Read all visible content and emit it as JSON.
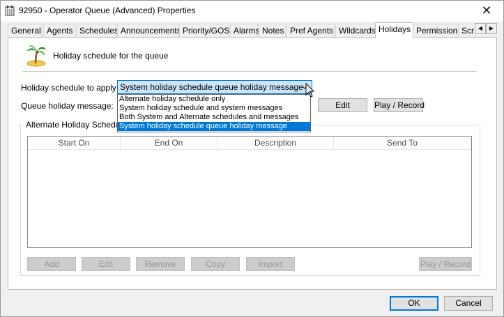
{
  "window": {
    "title": "92950 - Operator Queue (Advanced) Properties",
    "close_label": "✕"
  },
  "tabs": [
    {
      "label": "General"
    },
    {
      "label": "Agents"
    },
    {
      "label": "Schedules"
    },
    {
      "label": "Announcements"
    },
    {
      "label": "Priority/GOS"
    },
    {
      "label": "Alarms"
    },
    {
      "label": "Notes"
    },
    {
      "label": "Pref Agents"
    },
    {
      "label": "Wildcards"
    },
    {
      "label": "Holidays",
      "active": true
    },
    {
      "label": "Permissions"
    },
    {
      "label": "Scr"
    }
  ],
  "tab_scroll": {
    "left": "◀",
    "right": "▶"
  },
  "holidays": {
    "header": "Holiday schedule for the queue",
    "schedule_label": "Holiday schedule to apply:",
    "schedule_value": "System holiday schedule queue holiday message",
    "schedule_options": [
      "Alternate holiday schedule only",
      "System holiday schedule and system messages",
      "Both System and Alternate schedules and messages",
      "System holiday schedule queue holiday message"
    ],
    "selected_option_index": 3,
    "message_label": "Queue holiday message:",
    "edit_button": "Edit",
    "play_record_button": "Play / Record",
    "alternate_group_label": "Alternate Holiday Schedule",
    "columns": [
      "Start On",
      "End On",
      "Description",
      "Send To"
    ],
    "rows": [],
    "actions": {
      "add": "Add",
      "edit": "Edit",
      "remove": "Remove",
      "copy": "Copy",
      "import": "Import",
      "play_record": "Play / Record"
    }
  },
  "footer": {
    "ok": "OK",
    "cancel": "Cancel"
  },
  "icons": [
    "queue-app-icon",
    "palm-tree-icon",
    "chevron-down-icon",
    "mouse-cursor-icon"
  ],
  "colors": {
    "accent": "#0078d7",
    "selected_bg": "#cce4f7"
  }
}
